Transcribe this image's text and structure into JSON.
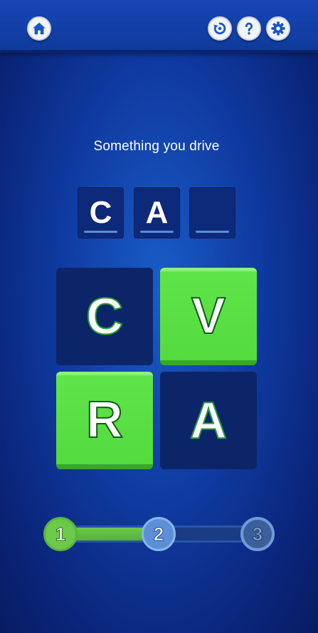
{
  "header": {
    "home_icon": "home-icon",
    "restart_icon": "restart-icon",
    "help_icon": "help-icon",
    "settings_icon": "gear-icon",
    "colors": {
      "bar": "#1646b4",
      "button": "#f2f4f8",
      "icon": "#1a56c4"
    }
  },
  "puzzle": {
    "clue": "Something you drive",
    "answer_slots": [
      "C",
      "A",
      ""
    ]
  },
  "tiles": [
    {
      "letter": "C",
      "state": "used"
    },
    {
      "letter": "V",
      "state": "available"
    },
    {
      "letter": "R",
      "state": "available"
    },
    {
      "letter": "A",
      "state": "used"
    }
  ],
  "progress": {
    "levels": [
      "1",
      "2",
      "3"
    ],
    "states": [
      "done",
      "current",
      "locked"
    ],
    "fill_fraction": 0.5,
    "colors": {
      "done": "#6cc94a",
      "current": "#5b90d8",
      "locked": "#3a5f9a"
    }
  }
}
